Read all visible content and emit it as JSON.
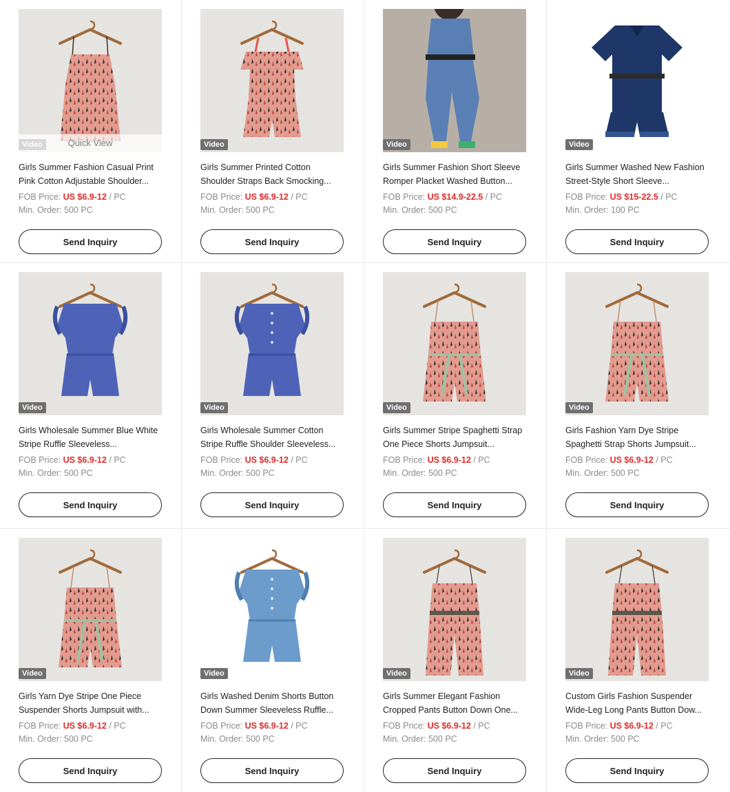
{
  "labels": {
    "video": "Video",
    "quick_view": "Quick View",
    "fob_price": "FOB Price:",
    "min_order": "Min. Order:",
    "send_inquiry": "Send Inquiry"
  },
  "products": [
    {
      "title": "Girls Summer Fashion Casual Print Pink Cotton Adjustable Shoulder...",
      "price": "US $6.9-12",
      "unit": "/ PC",
      "min_order": "500 PC",
      "style": "cami",
      "bg": "#e6e4e1",
      "color": "#e29b8e",
      "accent": "#2f2f2f",
      "pattern": "print"
    },
    {
      "title": "Girls Summer Printed Cotton Shoulder Straps Back Smocking...",
      "price": "US $6.9-12",
      "unit": "/ PC",
      "min_order": "500 PC",
      "style": "ruffle-cami",
      "bg": "#e6e4e1",
      "color": "#e4564a",
      "accent": "#ffffff",
      "pattern": "dots"
    },
    {
      "title": "Girls Summer Fashion Short Sleeve Romper Placket Washed Button...",
      "price": "US $14.9-22.5",
      "unit": "/ PC",
      "min_order": "500 PC",
      "style": "model",
      "bg": "#b7afa6",
      "color": "#5a7fb4",
      "accent": "#3f5f93",
      "pattern": "plain"
    },
    {
      "title": "Girls Summer Washed New Fashion Street-Style Short Sleeve...",
      "price": "US $15-22.5",
      "unit": "/ PC",
      "min_order": "100 PC",
      "style": "denim-romper",
      "bg": "#ffffff",
      "color": "#1e3668",
      "accent": "#2c2c2c",
      "pattern": "plain"
    },
    {
      "title": "Girls Wholesale Summer Blue White Stripe Ruffle Sleeveless...",
      "price": "US $6.9-12",
      "unit": "/ PC",
      "min_order": "500 PC",
      "style": "ruffle-romper",
      "bg": "#e6e4e1",
      "color": "#4e63b8",
      "accent": "#3b4f9e",
      "pattern": "plain"
    },
    {
      "title": "Girls Wholesale Summer Cotton Stripe Ruffle Shoulder Sleeveless...",
      "price": "US $6.9-12",
      "unit": "/ PC",
      "min_order": "500 PC",
      "style": "ruffle-romper",
      "bg": "#e6e4e1",
      "color": "#4e63b8",
      "accent": "#3b4f9e",
      "pattern": "buttons"
    },
    {
      "title": "Girls Summer Stripe Spaghetti Strap One Piece Shorts Jumpsuit...",
      "price": "US $6.9-12",
      "unit": "/ PC",
      "min_order": "500 PC",
      "style": "cami-romper",
      "bg": "#e6e4e1",
      "color": "#9fc2a3",
      "accent": "#c28f6e",
      "pattern": "stripes"
    },
    {
      "title": "Girls Fashion Yarn Dye Stripe Spaghetti Strap Shorts Jumpsuit...",
      "price": "US $6.9-12",
      "unit": "/ PC",
      "min_order": "500 PC",
      "style": "cami-romper",
      "bg": "#e6e4e1",
      "color": "#9fc2a3",
      "accent": "#c28f6e",
      "pattern": "stripes"
    },
    {
      "title": "Girls Yarn Dye Stripe One Piece Suspender Shorts Jumpsuit with...",
      "price": "US $6.9-12",
      "unit": "/ PC",
      "min_order": "500 PC",
      "style": "cami-romper",
      "bg": "#e6e4e1",
      "color": "#9fc2a3",
      "accent": "#c28f6e",
      "pattern": "stripes"
    },
    {
      "title": "Girls Washed Denim Shorts Button Down Summer Sleeveless Ruffle...",
      "price": "US $6.9-12",
      "unit": "/ PC",
      "min_order": "500 PC",
      "style": "ruffle-romper",
      "bg": "#ffffff",
      "color": "#6c9ccc",
      "accent": "#4f7fb0",
      "pattern": "buttons"
    },
    {
      "title": "Girls Summer Elegant Fashion Cropped Pants Button Down One...",
      "price": "US $6.9-12",
      "unit": "/ PC",
      "min_order": "500 PC",
      "style": "jumpsuit",
      "bg": "#e6e4e1",
      "color": "#8c8474",
      "accent": "#5d574c",
      "pattern": "stripes"
    },
    {
      "title": "Custom Girls Fashion Suspender Wide-Leg Long Pants Button Dow...",
      "price": "US $6.9-12",
      "unit": "/ PC",
      "min_order": "500 PC",
      "style": "jumpsuit",
      "bg": "#e6e4e1",
      "color": "#8a8577",
      "accent": "#5b564b",
      "pattern": "stripes"
    }
  ],
  "overlays": {
    "quick_view_on": 0,
    "video_badge_on": [
      0,
      1,
      2,
      3,
      4,
      5,
      6,
      7,
      8,
      9,
      10,
      11
    ]
  }
}
